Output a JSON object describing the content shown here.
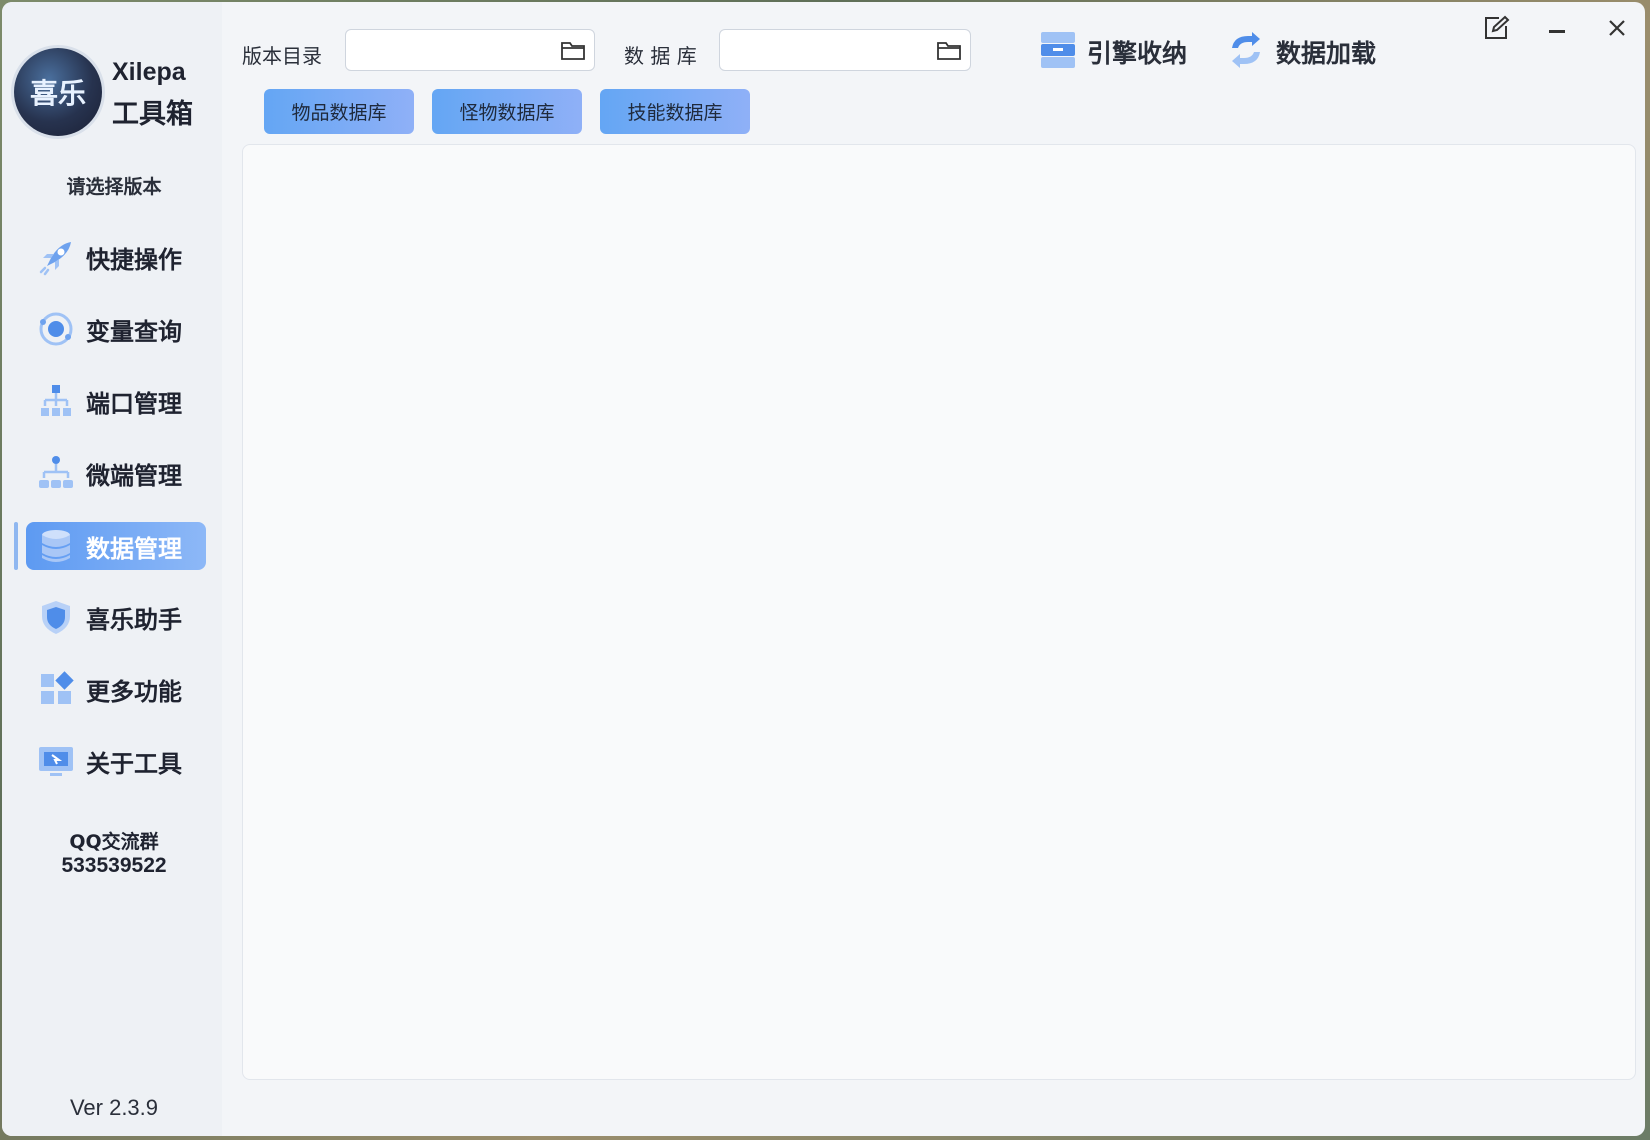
{
  "app": {
    "brand_name": "Xilepa",
    "brand_sub": "工具箱",
    "logo_text": "喜乐",
    "version_select": "请选择版本",
    "version": "Ver 2.3.9"
  },
  "topbar": {
    "version_dir_label": "版本目录",
    "version_dir_value": "",
    "database_label": "数 据 库",
    "database_value": "",
    "engine_label": "引擎收纳",
    "data_load_label": "数据加载"
  },
  "tabs": [
    {
      "label": "物品数据库"
    },
    {
      "label": "怪物数据库"
    },
    {
      "label": "技能数据库"
    }
  ],
  "sidebar": {
    "items": [
      {
        "label": "快捷操作",
        "icon": "rocket-icon"
      },
      {
        "label": "变量查询",
        "icon": "orbit-icon"
      },
      {
        "label": "端口管理",
        "icon": "network-icon"
      },
      {
        "label": "微端管理",
        "icon": "hierarchy-icon"
      },
      {
        "label": "数据管理",
        "icon": "database-icon",
        "active": true
      },
      {
        "label": "喜乐助手",
        "icon": "shield-icon"
      },
      {
        "label": "更多功能",
        "icon": "apps-icon"
      },
      {
        "label": "关于工具",
        "icon": "monitor-icon"
      }
    ],
    "qq_title": "QQ交流群",
    "qq_number": "533539522"
  },
  "colors": {
    "accent": "#5d9af2",
    "accent_light": "#8db8f7",
    "sidebar_bg": "#eef1f5",
    "window_bg": "#f3f5f8"
  }
}
